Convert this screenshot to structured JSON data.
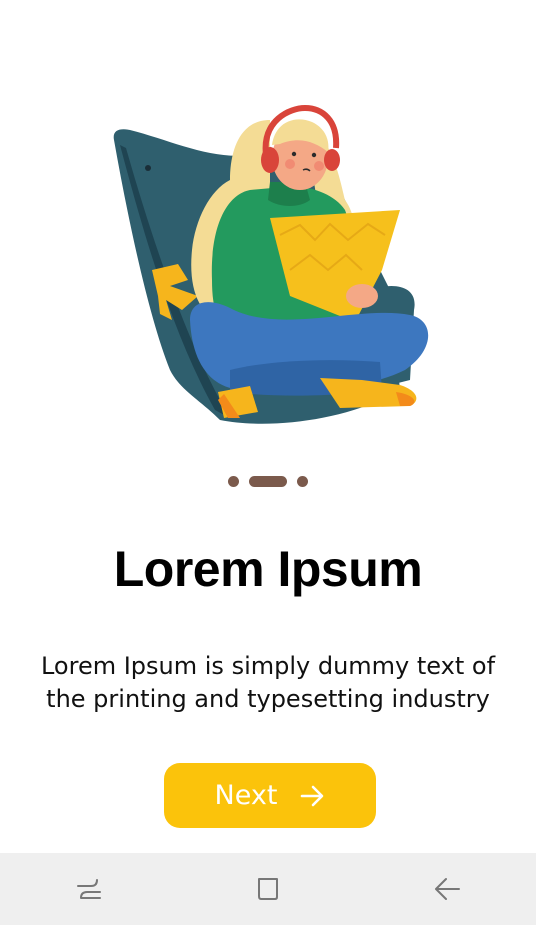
{
  "onboarding": {
    "title": "Lorem Ipsum",
    "description": "Lorem Ipsum is simply dummy text of the printing and typesetting industry",
    "next_label": "Next",
    "page_count": 3,
    "current_page": 2
  },
  "icons": {
    "next_button": "arrow-right-icon",
    "nav_recent": "recent-apps-icon",
    "nav_home": "home-icon",
    "nav_back": "back-icon"
  },
  "colors": {
    "accent": "#fbc30b",
    "indicator": "#7b5a4c",
    "nav_background": "#efefef"
  }
}
